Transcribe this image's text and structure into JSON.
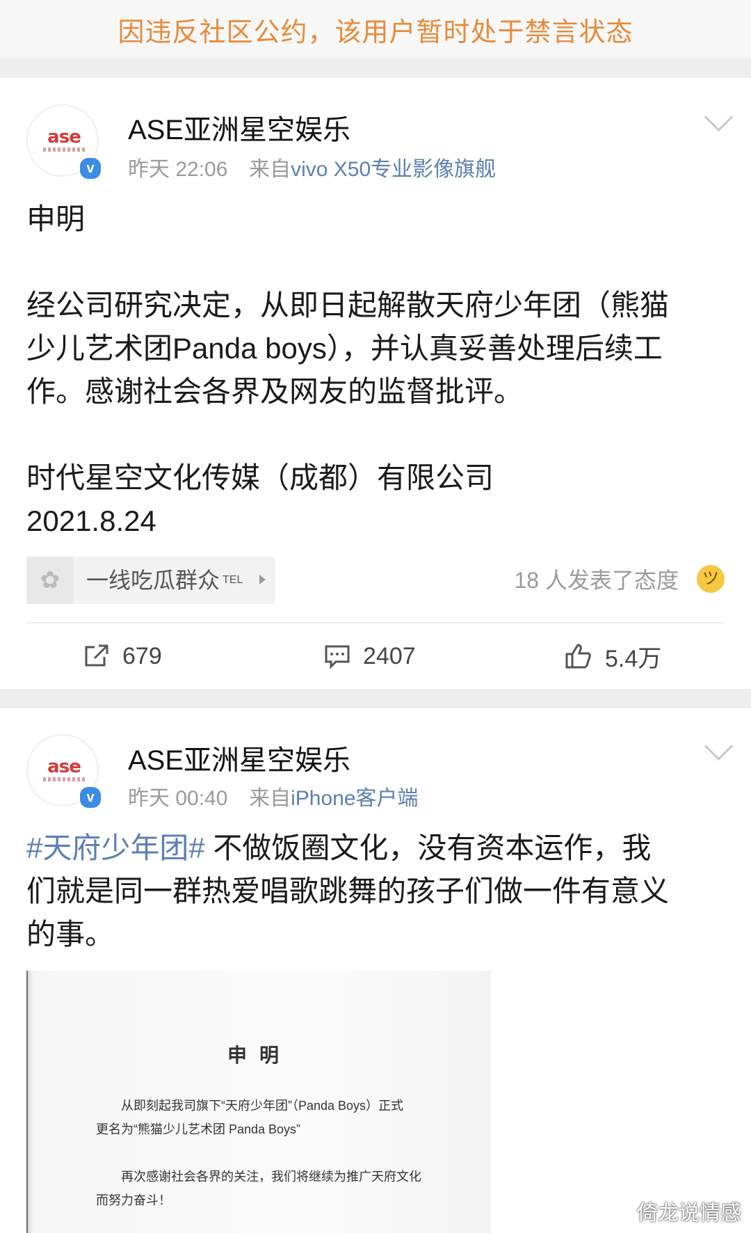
{
  "notice": "因违反社区公约，该用户暂时处于禁言状态",
  "posts": [
    {
      "author": "ASE亚洲星空娱乐",
      "time": "昨天 22:06",
      "source_prefix": "来自",
      "device": "vivo X50专业影像旗舰",
      "body_lines": [
        "申明",
        "",
        "经公司研究决定，从即日起解散天府少年团（熊猫",
        "少儿艺术团Panda boys），并认真妥善处理后续工",
        "作。感谢社会各界及网友的监督批评。",
        "",
        "时代星空文化传媒（成都）有限公司",
        "2021.8.24"
      ],
      "group": {
        "label": "一线吃瓜群众",
        "badge": "TEL"
      },
      "attitude_text": "18 人发表了态度",
      "actions": {
        "repost": "679",
        "comment": "2407",
        "like": "5.4万"
      }
    },
    {
      "author": "ASE亚洲星空娱乐",
      "time": "昨天 00:40",
      "source_prefix": "来自",
      "device": "iPhone客户端",
      "topic": "#天府少年团#",
      "body_first": " 不做饭圈文化，没有资本运作，我",
      "body_lines": [
        "们就是同一群热爱唱歌跳舞的孩子们做一件有意义",
        "的事。"
      ],
      "image": {
        "title": "申明",
        "lines": [
          "从即刻起我司旗下“天府少年团”（Panda Boys）正式",
          "更名为“熊猫少儿艺术团 Panda Boys”",
          "再次感谢社会各界的关注，我们将继续为推广天府文化",
          "而努力奋斗！"
        ]
      }
    }
  ],
  "logo_text": "ase",
  "verified_mark": "v",
  "watermark": "倚龙说情感",
  "colors": {
    "notice": "#e88a3a",
    "link": "#5b7fb4",
    "verified": "#3b8ce4"
  },
  "icons": [
    "repost-icon",
    "comment-icon",
    "like-icon",
    "chevron-down-icon",
    "group-icon",
    "laugh-emoji-icon",
    "verified-icon"
  ]
}
